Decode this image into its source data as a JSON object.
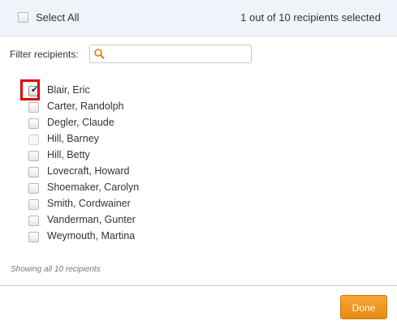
{
  "header": {
    "select_all_label": "Select All",
    "status": "1 out of 10 recipients selected"
  },
  "filter": {
    "label": "Filter recipients:",
    "value": "",
    "placeholder": ""
  },
  "recipients": [
    {
      "name": "Blair, Eric",
      "checked": true,
      "disabled": false
    },
    {
      "name": "Carter, Randolph",
      "checked": false,
      "disabled": false
    },
    {
      "name": "Degler, Claude",
      "checked": false,
      "disabled": false
    },
    {
      "name": "Hill, Barney",
      "checked": false,
      "disabled": true
    },
    {
      "name": "Hill, Betty",
      "checked": false,
      "disabled": false
    },
    {
      "name": "Lovecraft, Howard",
      "checked": false,
      "disabled": false
    },
    {
      "name": "Shoemaker, Carolyn",
      "checked": false,
      "disabled": false
    },
    {
      "name": "Smith, Cordwainer",
      "checked": false,
      "disabled": false
    },
    {
      "name": "Vanderman, Gunter",
      "checked": false,
      "disabled": false
    },
    {
      "name": "Weymouth, Martina",
      "checked": false,
      "disabled": false
    }
  ],
  "footer": {
    "summary": "Showing all 10 recipients",
    "done_label": "Done"
  },
  "colors": {
    "header_bg": "#eef4f9",
    "accent_button": "#f19a25",
    "highlight": "#e00000",
    "search_icon": "#e07b00"
  },
  "icons": {
    "search": "search-icon",
    "check": "checkmark-icon"
  }
}
